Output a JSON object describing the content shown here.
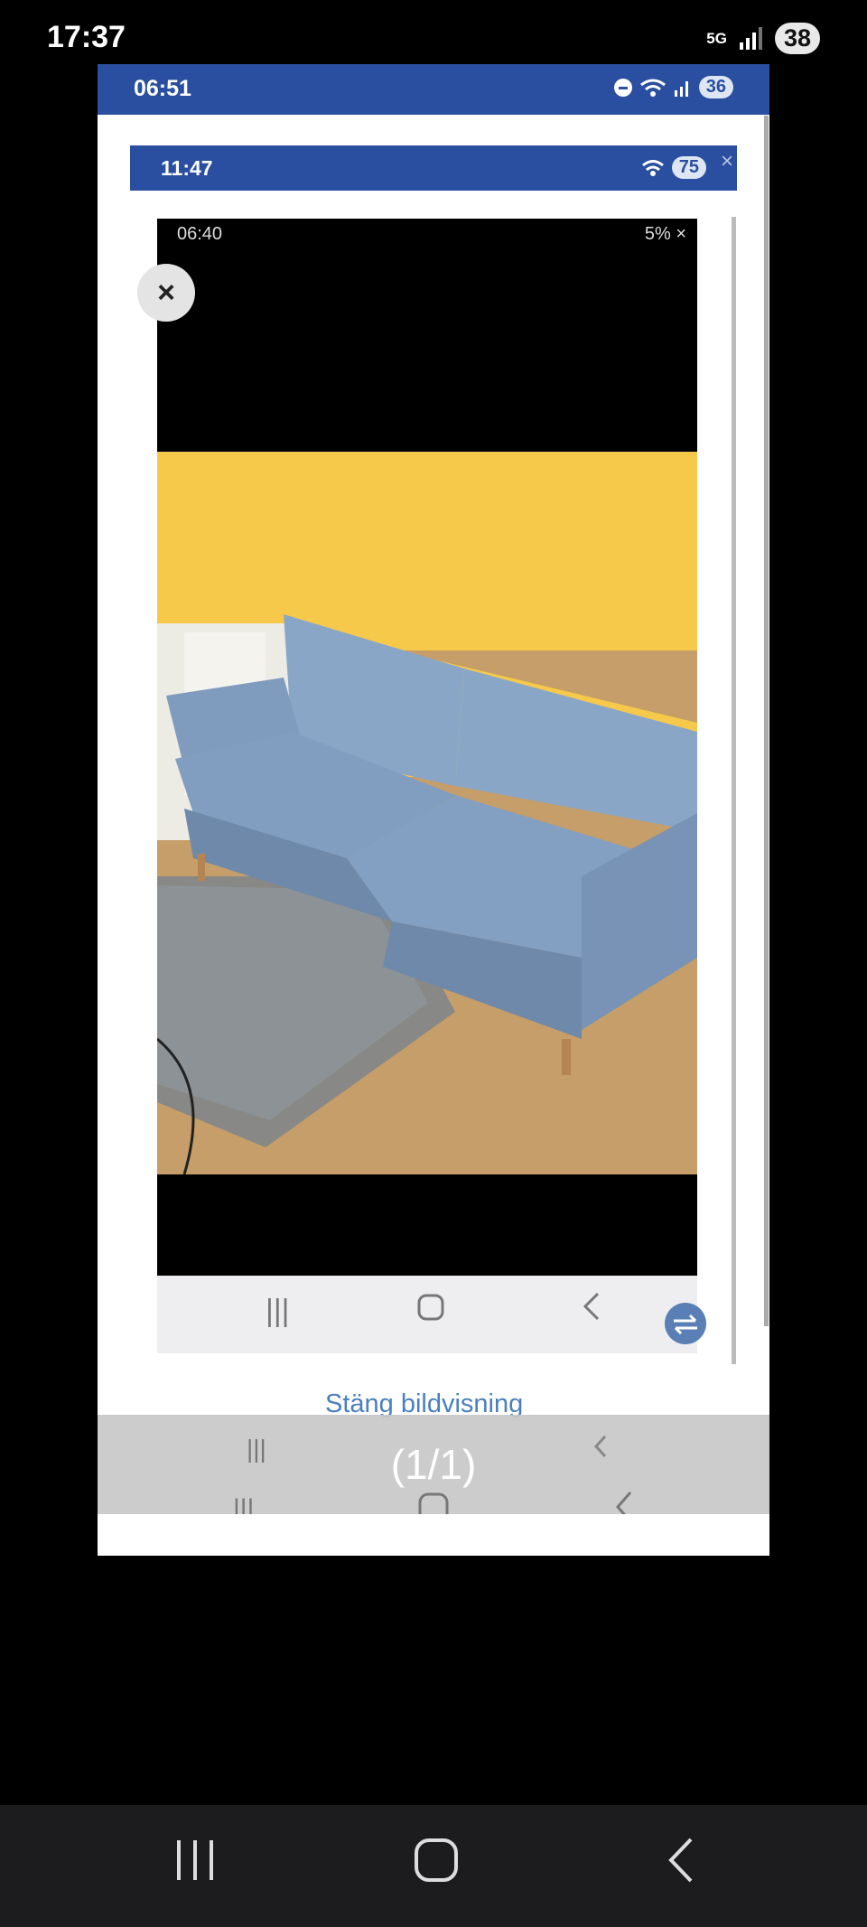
{
  "status_bar": {
    "time": "17:37",
    "network": "5G",
    "battery": "38"
  },
  "screenshot1": {
    "time": "06:51",
    "battery": "36"
  },
  "screenshot2": {
    "time": "11:47",
    "battery": "75",
    "close_glyph": "×"
  },
  "screenshot3": {
    "time": "06:40",
    "battery": "5%",
    "close_glyph": "×"
  },
  "viewer": {
    "close_glyph": "×",
    "counter": "(1/1)",
    "close_link": "Stäng bildvisning"
  },
  "icons": {
    "recents": "recents-icon",
    "home": "home-icon",
    "back": "back-icon",
    "close": "close-icon",
    "rotate": "rotate-icon"
  },
  "colors": {
    "blue_bar": "#2a4fa0",
    "wall_yellow": "#f6c94a",
    "sofa_blue": "#8aa6c7",
    "floor": "#c89f6b"
  }
}
